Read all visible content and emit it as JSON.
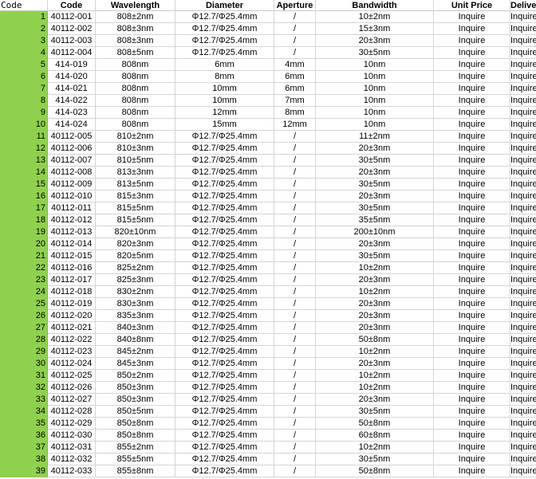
{
  "columns": {
    "index": "Code",
    "code": "Code",
    "wavelength": "Wavelength",
    "diameter": "Diameter",
    "aperture": "Aperture",
    "bandwidth": "Bandwidth",
    "unit_price": "Unit Price",
    "delivery": "Delivery"
  },
  "rows": [
    {
      "n": "1",
      "code": "40112-001",
      "wl": "808±2nm",
      "dia": "Φ12.7/Φ25.4mm",
      "ap": "/",
      "bw": "10±2nm",
      "price": "Inquire",
      "del": "Inquire"
    },
    {
      "n": "2",
      "code": "40112-002",
      "wl": "808±3nm",
      "dia": "Φ12.7/Φ25.4mm",
      "ap": "/",
      "bw": "15±3nm",
      "price": "Inquire",
      "del": "Inquire"
    },
    {
      "n": "3",
      "code": "40112-003",
      "wl": "808±3nm",
      "dia": "Φ12.7/Φ25.4mm",
      "ap": "/",
      "bw": "20±3nm",
      "price": "Inquire",
      "del": "Inquire"
    },
    {
      "n": "4",
      "code": "40112-004",
      "wl": "808±5nm",
      "dia": "Φ12.7/Φ25.4mm",
      "ap": "/",
      "bw": "30±5nm",
      "price": "Inquire",
      "del": "Inquire"
    },
    {
      "n": "5",
      "code": "414-019",
      "wl": "808nm",
      "dia": "6mm",
      "ap": "4mm",
      "bw": "10nm",
      "price": "Inquire",
      "del": "Inquire"
    },
    {
      "n": "6",
      "code": "414-020",
      "wl": "808nm",
      "dia": "8mm",
      "ap": "6mm",
      "bw": "10nm",
      "price": "Inquire",
      "del": "Inquire"
    },
    {
      "n": "7",
      "code": "414-021",
      "wl": "808nm",
      "dia": "10mm",
      "ap": "6mm",
      "bw": "10nm",
      "price": "Inquire",
      "del": "Inquire"
    },
    {
      "n": "8",
      "code": "414-022",
      "wl": "808nm",
      "dia": "10mm",
      "ap": "7mm",
      "bw": "10nm",
      "price": "Inquire",
      "del": "Inquire"
    },
    {
      "n": "9",
      "code": "414-023",
      "wl": "808nm",
      "dia": "12mm",
      "ap": "8mm",
      "bw": "10nm",
      "price": "Inquire",
      "del": "Inquire"
    },
    {
      "n": "10",
      "code": "414-024",
      "wl": "808nm",
      "dia": "15mm",
      "ap": "12mm",
      "bw": "10nm",
      "price": "Inquire",
      "del": "Inquire"
    },
    {
      "n": "11",
      "code": "40112-005",
      "wl": "810±2nm",
      "dia": "Φ12.7/Φ25.4mm",
      "ap": "/",
      "bw": "11±2nm",
      "price": "Inquire",
      "del": "Inquire"
    },
    {
      "n": "12",
      "code": "40112-006",
      "wl": "810±3nm",
      "dia": "Φ12.7/Φ25.4mm",
      "ap": "/",
      "bw": "20±3nm",
      "price": "Inquire",
      "del": "Inquire"
    },
    {
      "n": "13",
      "code": "40112-007",
      "wl": "810±5nm",
      "dia": "Φ12.7/Φ25.4mm",
      "ap": "/",
      "bw": "30±5nm",
      "price": "Inquire",
      "del": "Inquire"
    },
    {
      "n": "14",
      "code": "40112-008",
      "wl": "813±3nm",
      "dia": "Φ12.7/Φ25.4mm",
      "ap": "/",
      "bw": "20±3nm",
      "price": "Inquire",
      "del": "Inquire"
    },
    {
      "n": "15",
      "code": "40112-009",
      "wl": "813±5nm",
      "dia": "Φ12.7/Φ25.4mm",
      "ap": "/",
      "bw": "30±5nm",
      "price": "Inquire",
      "del": "Inquire"
    },
    {
      "n": "16",
      "code": "40112-010",
      "wl": "815±3nm",
      "dia": "Φ12.7/Φ25.4mm",
      "ap": "/",
      "bw": "20±3nm",
      "price": "Inquire",
      "del": "Inquire"
    },
    {
      "n": "17",
      "code": "40112-011",
      "wl": "815±5nm",
      "dia": "Φ12.7/Φ25.4mm",
      "ap": "/",
      "bw": "30±5nm",
      "price": "Inquire",
      "del": "Inquire"
    },
    {
      "n": "18",
      "code": "40112-012",
      "wl": "815±5nm",
      "dia": "Φ12.7/Φ25.4mm",
      "ap": "/",
      "bw": "35±5nm",
      "price": "Inquire",
      "del": "Inquire"
    },
    {
      "n": "19",
      "code": "40112-013",
      "wl": "820±10nm",
      "dia": "Φ12.7/Φ25.4mm",
      "ap": "/",
      "bw": "200±10nm",
      "price": "Inquire",
      "del": "Inquire"
    },
    {
      "n": "20",
      "code": "40112-014",
      "wl": "820±3nm",
      "dia": "Φ12.7/Φ25.4mm",
      "ap": "/",
      "bw": "20±3nm",
      "price": "Inquire",
      "del": "Inquire"
    },
    {
      "n": "21",
      "code": "40112-015",
      "wl": "820±5nm",
      "dia": "Φ12.7/Φ25.4mm",
      "ap": "/",
      "bw": "30±5nm",
      "price": "Inquire",
      "del": "Inquire"
    },
    {
      "n": "22",
      "code": "40112-016",
      "wl": "825±2nm",
      "dia": "Φ12.7/Φ25.4mm",
      "ap": "/",
      "bw": "10±2nm",
      "price": "Inquire",
      "del": "Inquire"
    },
    {
      "n": "23",
      "code": "40112-017",
      "wl": "825±3nm",
      "dia": "Φ12.7/Φ25.4mm",
      "ap": "/",
      "bw": "20±3nm",
      "price": "Inquire",
      "del": "Inquire"
    },
    {
      "n": "24",
      "code": "40112-018",
      "wl": "830±2nm",
      "dia": "Φ12.7/Φ25.4mm",
      "ap": "/",
      "bw": "10±2nm",
      "price": "Inquire",
      "del": "Inquire"
    },
    {
      "n": "25",
      "code": "40112-019",
      "wl": "830±3nm",
      "dia": "Φ12.7/Φ25.4mm",
      "ap": "/",
      "bw": "20±3nm",
      "price": "Inquire",
      "del": "Inquire"
    },
    {
      "n": "26",
      "code": "40112-020",
      "wl": "835±3nm",
      "dia": "Φ12.7/Φ25.4mm",
      "ap": "/",
      "bw": "20±3nm",
      "price": "Inquire",
      "del": "Inquire"
    },
    {
      "n": "27",
      "code": "40112-021",
      "wl": "840±3nm",
      "dia": "Φ12.7/Φ25.4mm",
      "ap": "/",
      "bw": "20±3nm",
      "price": "Inquire",
      "del": "Inquire"
    },
    {
      "n": "28",
      "code": "40112-022",
      "wl": "840±8nm",
      "dia": "Φ12.7/Φ25.4mm",
      "ap": "/",
      "bw": "50±8nm",
      "price": "Inquire",
      "del": "Inquire"
    },
    {
      "n": "29",
      "code": "40112-023",
      "wl": "845±2nm",
      "dia": "Φ12.7/Φ25.4mm",
      "ap": "/",
      "bw": "10±2nm",
      "price": "Inquire",
      "del": "Inquire"
    },
    {
      "n": "30",
      "code": "40112-024",
      "wl": "845±3nm",
      "dia": "Φ12.7/Φ25.4mm",
      "ap": "/",
      "bw": "20±3nm",
      "price": "Inquire",
      "del": "Inquire"
    },
    {
      "n": "31",
      "code": "40112-025",
      "wl": "850±2nm",
      "dia": "Φ12.7/Φ25.4mm",
      "ap": "/",
      "bw": "10±2nm",
      "price": "Inquire",
      "del": "Inquire"
    },
    {
      "n": "32",
      "code": "40112-026",
      "wl": "850±3nm",
      "dia": "Φ12.7/Φ25.4mm",
      "ap": "/",
      "bw": "10±2nm",
      "price": "Inquire",
      "del": "Inquire"
    },
    {
      "n": "33",
      "code": "40112-027",
      "wl": "850±3nm",
      "dia": "Φ12.7/Φ25.4mm",
      "ap": "/",
      "bw": "20±3nm",
      "price": "Inquire",
      "del": "Inquire"
    },
    {
      "n": "34",
      "code": "40112-028",
      "wl": "850±5nm",
      "dia": "Φ12.7/Φ25.4mm",
      "ap": "/",
      "bw": "30±5nm",
      "price": "Inquire",
      "del": "Inquire"
    },
    {
      "n": "35",
      "code": "40112-029",
      "wl": "850±8nm",
      "dia": "Φ12.7/Φ25.4mm",
      "ap": "/",
      "bw": "50±8nm",
      "price": "Inquire",
      "del": "Inquire"
    },
    {
      "n": "36",
      "code": "40112-030",
      "wl": "850±8nm",
      "dia": "Φ12.7/Φ25.4mm",
      "ap": "/",
      "bw": "60±8nm",
      "price": "Inquire",
      "del": "Inquire"
    },
    {
      "n": "37",
      "code": "40112-031",
      "wl": "855±2nm",
      "dia": "Φ12.7/Φ25.4mm",
      "ap": "/",
      "bw": "10±2nm",
      "price": "Inquire",
      "del": "Inquire"
    },
    {
      "n": "38",
      "code": "40112-032",
      "wl": "855±5nm",
      "dia": "Φ12.7/Φ25.4mm",
      "ap": "/",
      "bw": "30±5nm",
      "price": "Inquire",
      "del": "Inquire"
    },
    {
      "n": "39",
      "code": "40112-033",
      "wl": "855±8nm",
      "dia": "Φ12.7/Φ25.4mm",
      "ap": "/",
      "bw": "50±8nm",
      "price": "Inquire",
      "del": "Inquire"
    }
  ]
}
